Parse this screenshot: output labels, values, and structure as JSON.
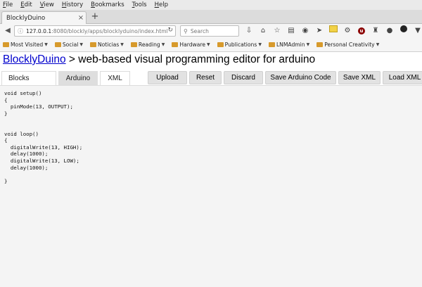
{
  "menu": [
    "File",
    "Edit",
    "View",
    "History",
    "Bookmarks",
    "Tools",
    "Help"
  ],
  "browser_tab": {
    "title": "BlocklyDuino",
    "close": "×",
    "new": "+"
  },
  "url": {
    "host": "127.0.0.1",
    "path": ":8080/blockly/apps/blocklyduino/index.html"
  },
  "search": {
    "placeholder": "Search"
  },
  "bookmarks": [
    "Most Visited",
    "Social",
    "Noticias",
    "Reading",
    "Hardware",
    "Publications",
    "LNMAdmin",
    "Personal Creativity"
  ],
  "page": {
    "title_link": "BlocklyDuino",
    "title_rest": " > web-based visual programming editor for arduino"
  },
  "tabs": {
    "blocks": "Blocks",
    "arduino": "Arduino",
    "xml": "XML"
  },
  "buttons": {
    "upload": "Upload",
    "reset": "Reset",
    "discard": "Discard",
    "save_arduino": "Save Arduino Code",
    "save_xml": "Save XML",
    "load_xml": "Load XML"
  },
  "code": "void setup()\n{\n  pinMode(13, OUTPUT);\n}\n\n\nvoid loop()\n{\n  digitalWrite(13, HIGH);\n  delay(1000);\n  digitalWrite(13, LOW);\n  delay(1000);\n\n}"
}
